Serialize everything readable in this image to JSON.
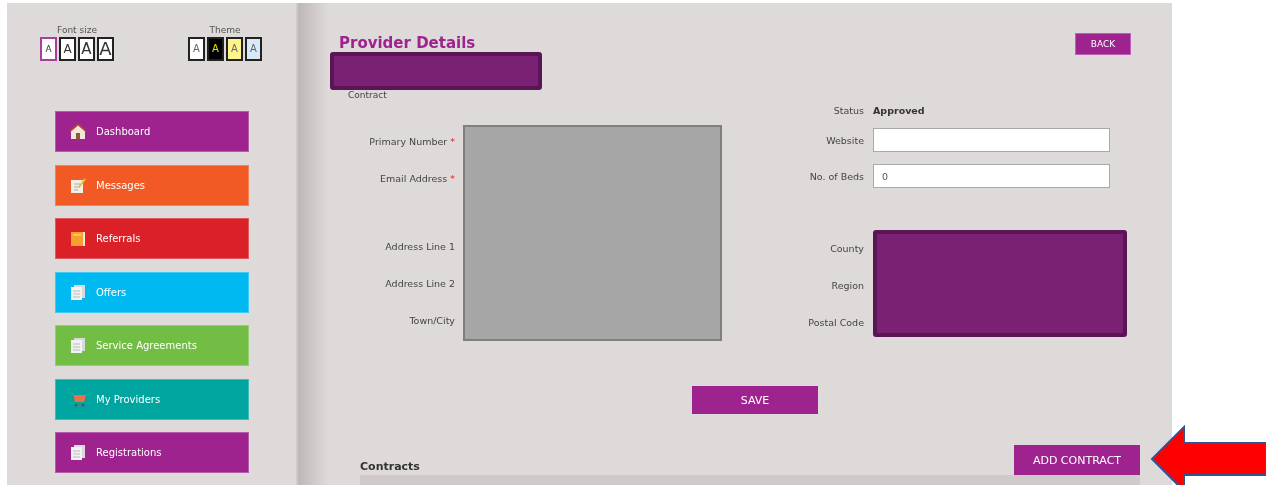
{
  "font_size": {
    "label": "Font size",
    "options": [
      {
        "label": "A",
        "selected": true
      },
      {
        "label": "A",
        "selected": false
      },
      {
        "label": "A",
        "selected": false
      },
      {
        "label": "A",
        "selected": false
      }
    ]
  },
  "theme": {
    "label": "Theme",
    "options": [
      {
        "label": "A",
        "color": "#ffffff",
        "selected": false
      },
      {
        "label": "A",
        "color": "#000000",
        "selected": false
      },
      {
        "label": "A",
        "color": "#fdf58c",
        "selected": false
      },
      {
        "label": "A",
        "color": "#d8eaf7",
        "selected": false
      }
    ]
  },
  "sidebar": {
    "items": [
      {
        "label": "Dashboard",
        "color": "#9e238f"
      },
      {
        "label": "Messages",
        "color": "#f15a24"
      },
      {
        "label": "Referrals",
        "color": "#da2128"
      },
      {
        "label": "Offers",
        "color": "#00b9f1"
      },
      {
        "label": "Service Agreements",
        "color": "#72be44"
      },
      {
        "label": "My Providers",
        "color": "#00a5a0"
      },
      {
        "label": "Registrations",
        "color": "#9e238f"
      }
    ]
  },
  "page": {
    "title": "Provider Details",
    "subtitle": "Contract",
    "back_button": "BACK"
  },
  "left_fields": [
    {
      "label": "Primary Number",
      "required_mark": "*"
    },
    {
      "label": "Email Address",
      "required_mark": "*"
    },
    {
      "label": "Address Line 1"
    },
    {
      "label": "Address Line 2"
    },
    {
      "label": "Town/City"
    }
  ],
  "status": {
    "label": "Status",
    "value": "Approved"
  },
  "right_inputs": [
    {
      "label": "Website"
    },
    {
      "label": "No. of Beds",
      "value": "0"
    }
  ],
  "right_fields": [
    {
      "label": "County"
    },
    {
      "label": "Region"
    },
    {
      "label": "Postal Code"
    }
  ],
  "save_button": "SAVE",
  "contracts": {
    "title": "Contracts",
    "add_button": "ADD CONTRACT"
  }
}
